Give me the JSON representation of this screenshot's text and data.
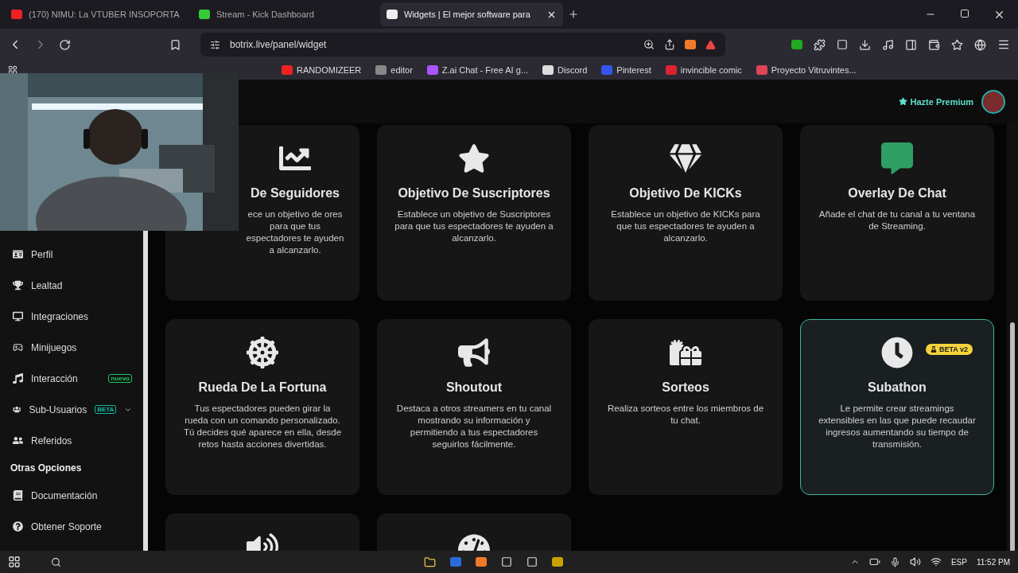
{
  "browser": {
    "tabs": [
      {
        "title": "(170) NIMU: La VTUBER INSOPORTA",
        "selected": false
      },
      {
        "title": "Stream - Kick Dashboard",
        "selected": false
      },
      {
        "title": "Widgets | El mejor software para",
        "selected": true
      }
    ],
    "url": "botrix.live/panel/widget",
    "bookmarks": [
      {
        "label": "RANDOMIZEER"
      },
      {
        "label": "editor"
      },
      {
        "label": "Z.ai Chat - Free AI g..."
      },
      {
        "label": "Discord"
      },
      {
        "label": "Pinterest"
      },
      {
        "label": "invincible comic"
      },
      {
        "label": "Proyecto Vitruvintes..."
      }
    ]
  },
  "header": {
    "premium_link": "Hazte Premium"
  },
  "sidebar": {
    "items": [
      {
        "label": "Perfil"
      },
      {
        "label": "Lealtad"
      },
      {
        "label": "Integraciones"
      },
      {
        "label": "Minijuegos"
      },
      {
        "label": "Interacción",
        "badge": {
          "text": "nuevo",
          "color": "#22c55e"
        }
      },
      {
        "label": "Sub-Usuarios",
        "badge": {
          "text": "BETA",
          "color": "#14b8a6"
        },
        "expanded": false
      },
      {
        "label": "Referidos"
      }
    ],
    "section_title": "Otras Opciones",
    "other_items": [
      {
        "label": "Documentación"
      },
      {
        "label": "Obtener Soporte"
      }
    ]
  },
  "widgets": [
    {
      "kind": "partly_hidden",
      "title": "De Seguidores",
      "description": "ece un objetivo de ores para que tus espectadores te ayuden a alcanzarlo.",
      "selected": false
    },
    {
      "kind": "card",
      "title": "Objetivo De Suscriptores",
      "description": "Establece un objetivo de Suscriptores para que tus espectadores te ayuden a alcanzarlo.",
      "selected": false
    },
    {
      "kind": "card",
      "title": "Objetivo De KICKs",
      "description": "Establece un objetivo de KICKs para que tus espectadores te ayuden a alcanzarlo.",
      "selected": false
    },
    {
      "kind": "card",
      "title": "Overlay De Chat",
      "description": "Añade el chat de tu canal a tu ventana de Streaming.",
      "selected": false
    },
    {
      "kind": "card",
      "title": "Rueda De La Fortuna",
      "description": "Tus espectadores pueden girar la rueda con un comando personalizado. Tú decides qué aparece en ella, desde retos hasta acciones divertidas.",
      "selected": false
    },
    {
      "kind": "card",
      "title": "Shoutout",
      "description": "Destaca a otros streamers en tu canal mostrando su información y permitiendo a tus espectadores seguirlos fácilmente.",
      "selected": false
    },
    {
      "kind": "card",
      "title": "Sorteos",
      "description": "Realiza sorteos entre los miembros de tu chat.",
      "selected": false
    },
    {
      "kind": "card",
      "title": "Subathon",
      "description": "Le permite crear streamings extensibles en las que puede recaudar ingresos aumentando su tiempo de transmisión.",
      "selected": true,
      "badge": "BETA v2"
    },
    {
      "kind": "cut_off",
      "selected": false
    },
    {
      "kind": "cut_off",
      "selected": false
    }
  ],
  "taskbar": {
    "language": "ESP",
    "time": "11:52 PM"
  }
}
